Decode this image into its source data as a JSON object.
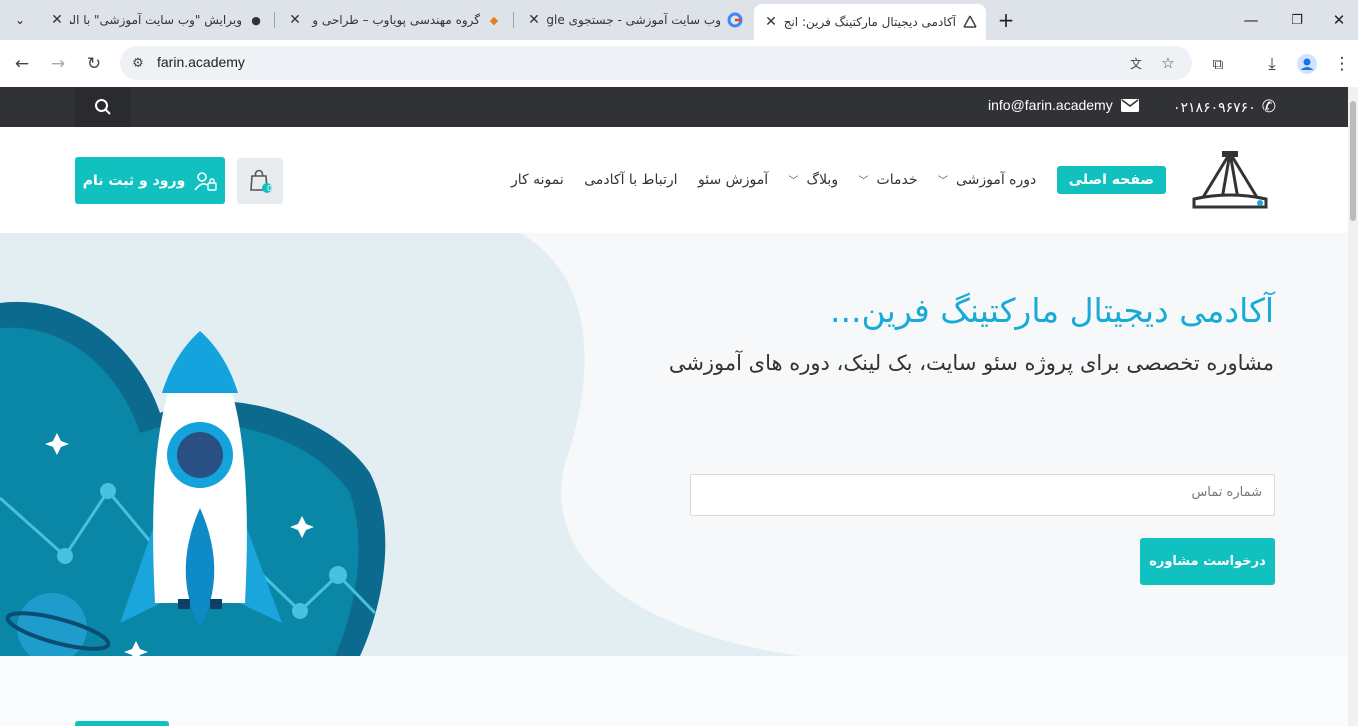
{
  "browser": {
    "tabs": [
      {
        "title": "ویرایش \"وب سایت آموزشی\" با الم"
      },
      {
        "title": "گروه مهندسی پویاوب – طراحی و"
      },
      {
        "title": "وب سایت آموزشی - جستجوی Google"
      },
      {
        "title": "آکادمی دیجیتال مارکتینگ فرین: انج"
      }
    ],
    "url": "farin.academy",
    "new_tab_label": "+"
  },
  "topbar": {
    "email": "info@farin.academy",
    "phone": "۰۲۱۸۶۰۹۶۷۶۰"
  },
  "nav": {
    "items": [
      "صفحه اصلی",
      "دوره آموزشی",
      "خدمات",
      "وبلاگ",
      "آموزش سئو",
      "ارتباط با آکادمی",
      "نمونه کار"
    ],
    "login_label": "ورود و ثبت نام",
    "cart_count": "0"
  },
  "hero": {
    "title": "آکادمی دیجیتال مارکتینگ فرین...",
    "subtitle": "مشاوره تخصصی برای پروژه سئو سایت، بک لینک، دوره های آموزشی",
    "phone_placeholder": "شماره تماس",
    "cta_label": "درخواست مشاوره"
  },
  "colors": {
    "accent": "#10c1c0",
    "title": "#18abd8",
    "topbar": "#313236"
  }
}
